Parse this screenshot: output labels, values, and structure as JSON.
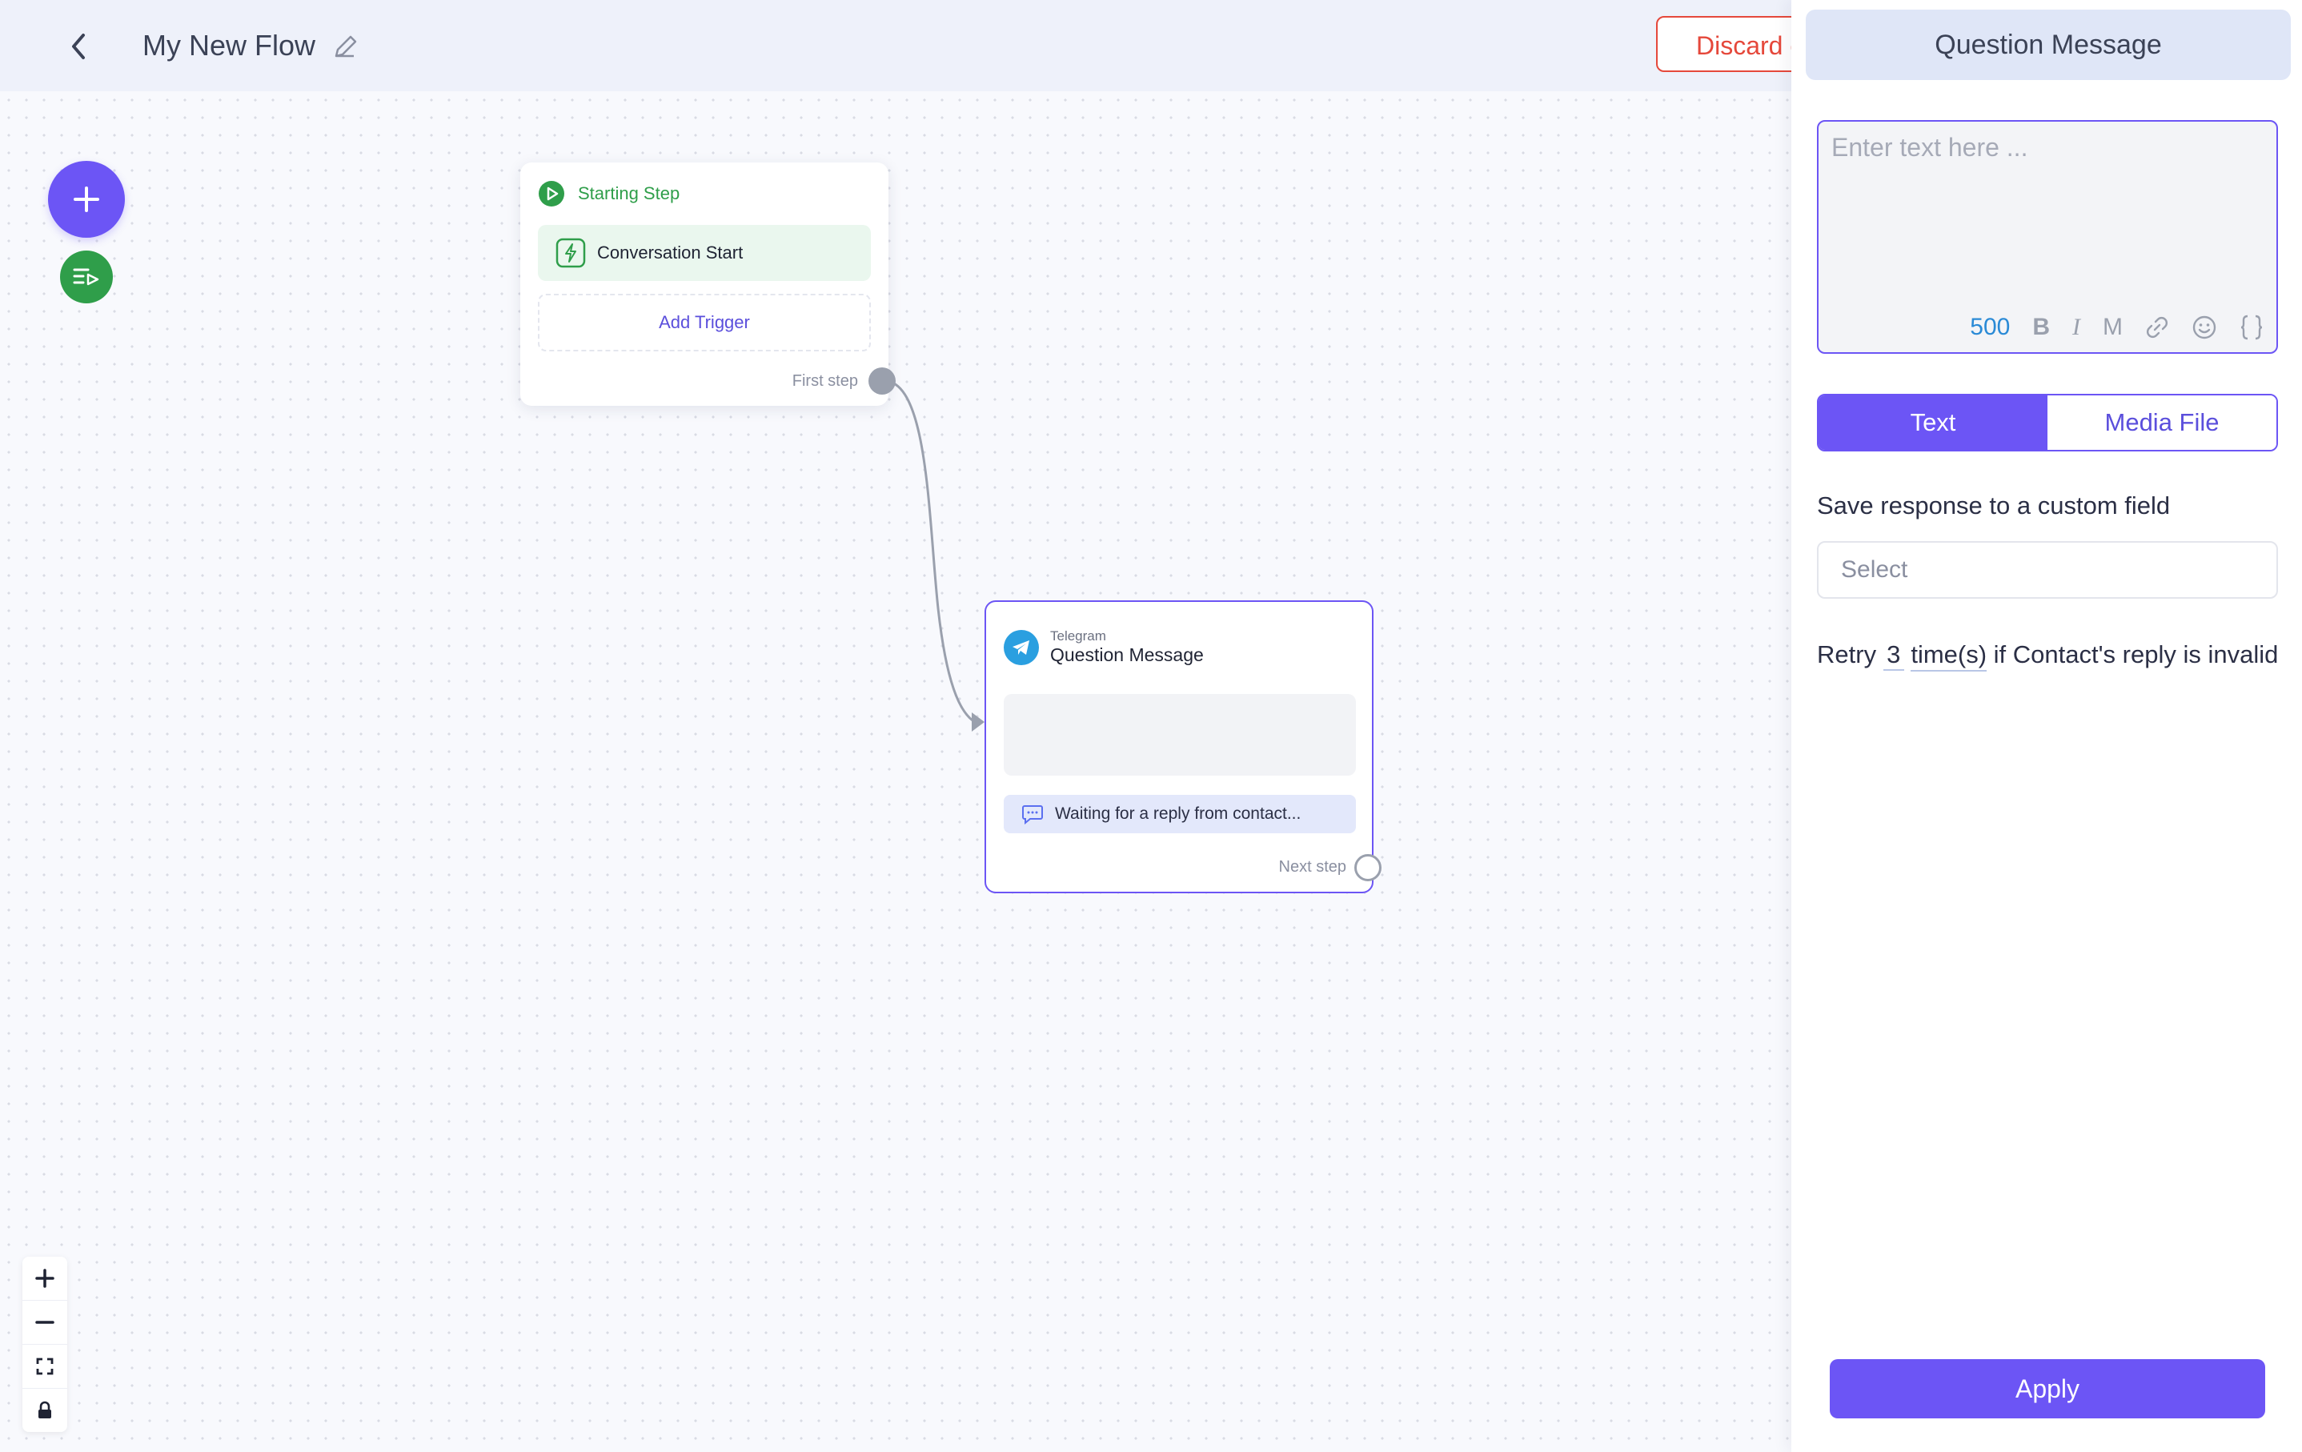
{
  "header": {
    "flow_title": "My New Flow",
    "discard_label": "Discard c"
  },
  "canvas": {
    "start_node": {
      "title": "Starting Step",
      "trigger_label": "Conversation Start",
      "add_trigger_label": "Add Trigger",
      "first_step_label": "First step"
    },
    "question_node": {
      "channel": "Telegram",
      "title": "Question Message",
      "waiting_label": "Waiting for a reply from contact...",
      "next_step_label": "Next step"
    },
    "zoom_controls": [
      "plus-icon",
      "minus-icon",
      "fit-view-icon",
      "lock-icon"
    ]
  },
  "panel": {
    "title": "Question Message",
    "editor": {
      "placeholder": "Enter text here ...",
      "value": "",
      "char_count": "500",
      "tools": [
        "B",
        "I",
        "M"
      ]
    },
    "tabs": [
      {
        "label": "Text",
        "active": true
      },
      {
        "label": "Media File",
        "active": false
      }
    ],
    "save_response_label": "Save response to a custom field",
    "select_placeholder": "Select",
    "retry": {
      "prefix": "Retry",
      "count": "3",
      "unit": "time(s)",
      "suffix": "if Contact's reply is invalid"
    },
    "apply_label": "Apply"
  },
  "colors": {
    "accent": "#6c55f5",
    "green": "#2f9e4a",
    "danger": "#e5483b",
    "telegram": "#2a9fe0"
  }
}
